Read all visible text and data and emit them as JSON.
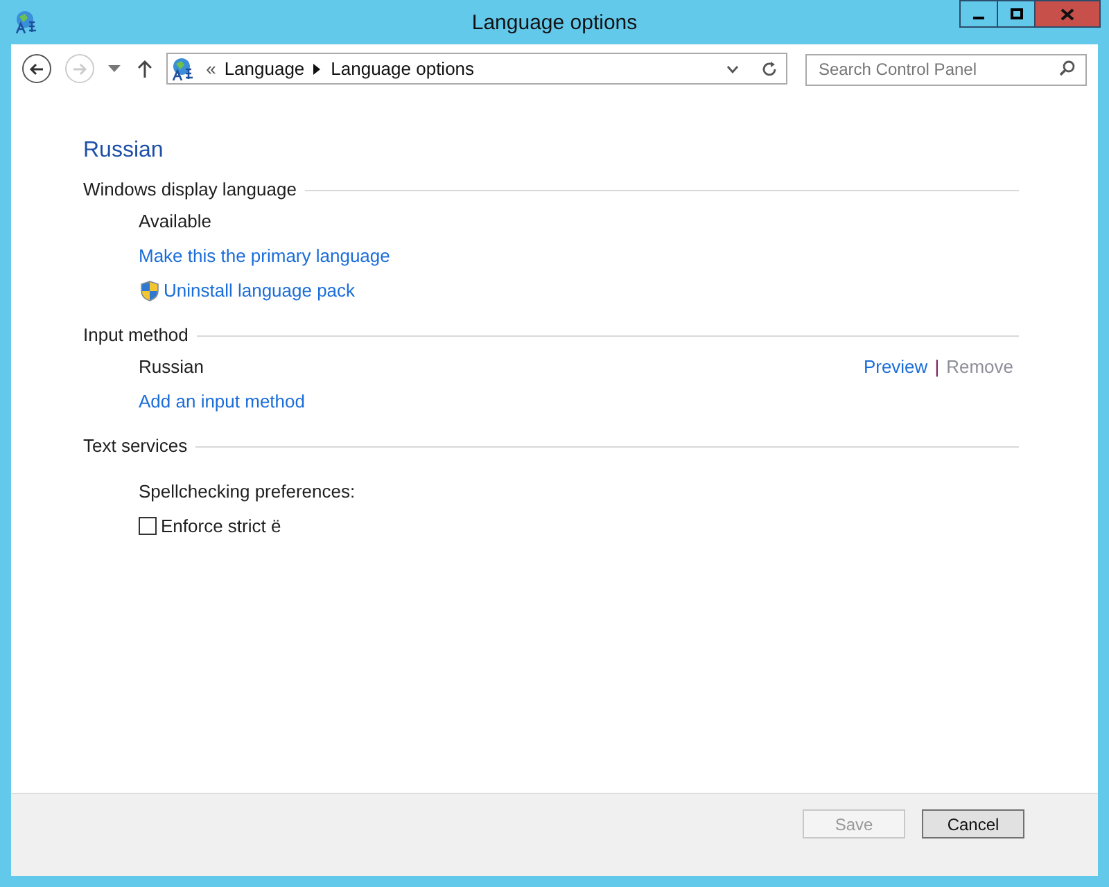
{
  "window": {
    "title": "Language options"
  },
  "address": {
    "path": [
      {
        "label": "Language"
      },
      {
        "label": "Language options"
      }
    ],
    "overflow": "«"
  },
  "search": {
    "placeholder": "Search Control Panel"
  },
  "nav": {
    "back_disabled": false,
    "forward_disabled": true
  },
  "heading": "Russian",
  "sections": [
    {
      "title": "Windows display language",
      "items": [
        {
          "kind": "text",
          "label": "Available"
        },
        {
          "kind": "link",
          "label": "Make this the primary language"
        },
        {
          "kind": "shield_link",
          "label": "Uninstall language pack"
        }
      ]
    },
    {
      "title": "Input method",
      "items": [
        {
          "kind": "method",
          "label": "Russian",
          "separator": "|",
          "actions": [
            {
              "label": "Preview",
              "disabled": false
            },
            {
              "label": "Remove",
              "disabled": true
            }
          ]
        },
        {
          "kind": "link",
          "label": "Add an input method"
        }
      ]
    },
    {
      "title": "Text services",
      "items": [
        {
          "kind": "text",
          "label": "Spellchecking preferences:"
        },
        {
          "kind": "checkbox",
          "label": "Enforce strict ë",
          "checked": false
        }
      ]
    }
  ],
  "buttons": [
    {
      "label": "Save",
      "disabled": true
    },
    {
      "label": "Cancel",
      "disabled": false
    }
  ]
}
